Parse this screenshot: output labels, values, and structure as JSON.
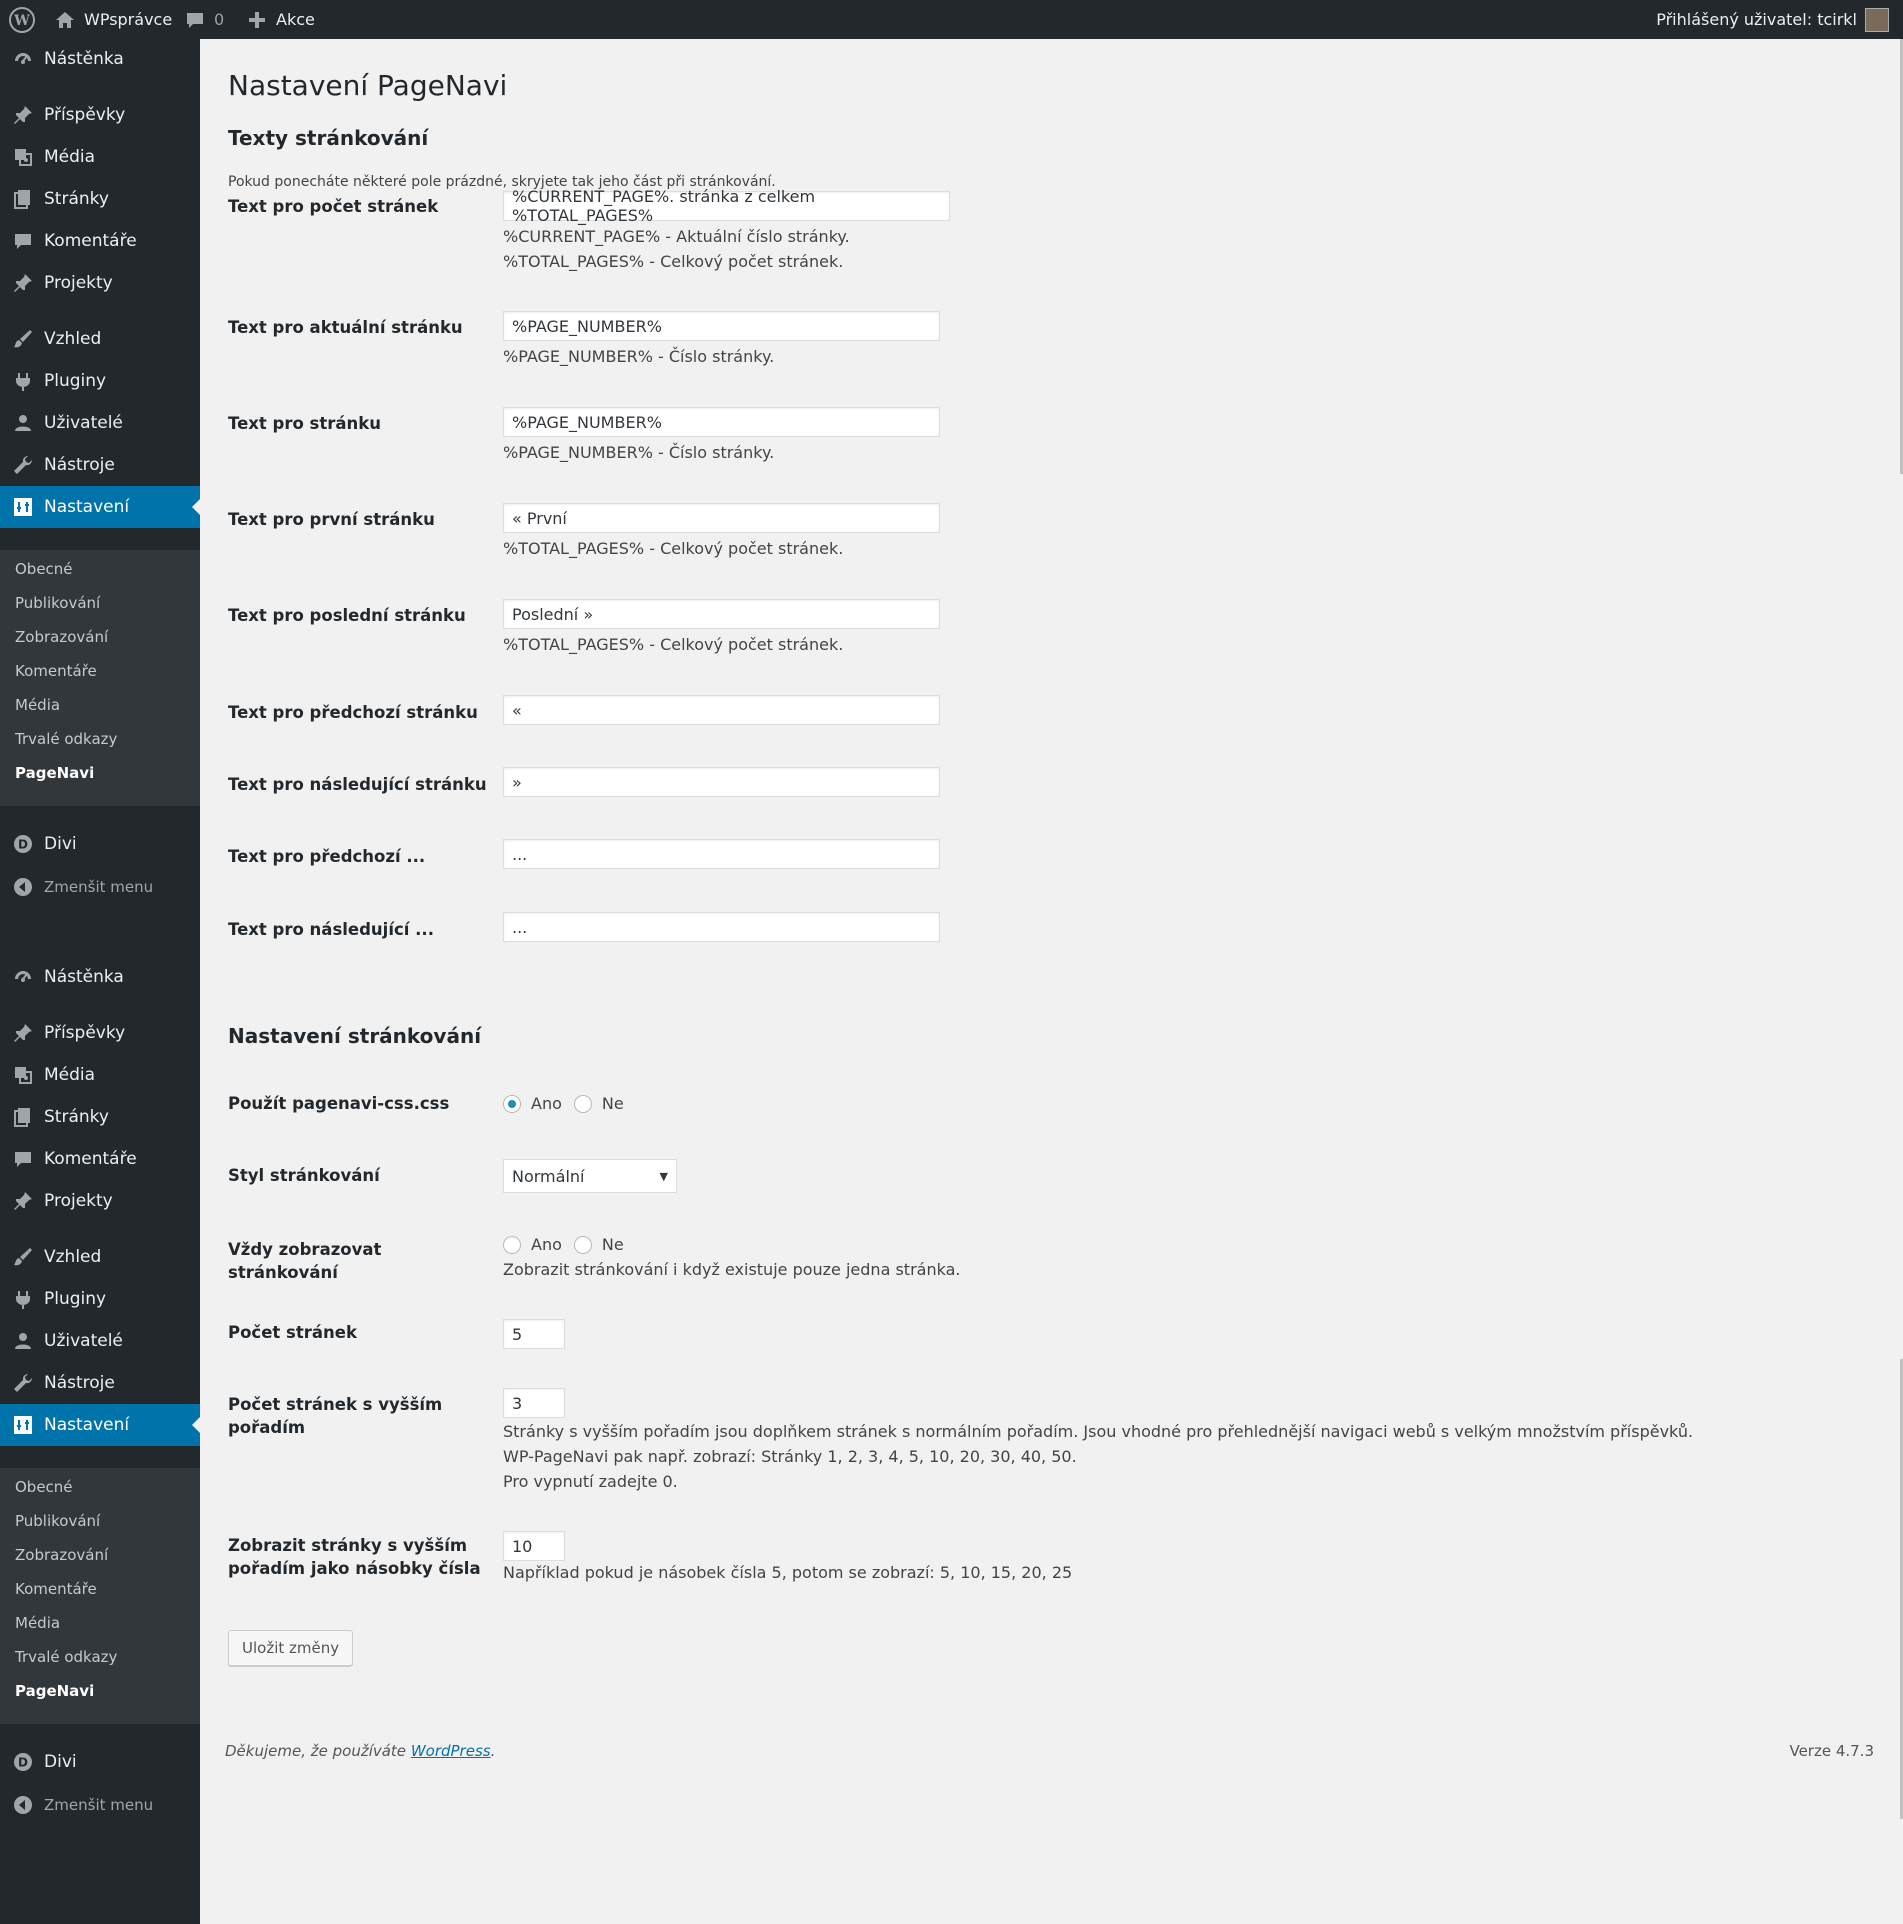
{
  "adminbar": {
    "site_name": "WPsprávce",
    "comments_count": "0",
    "new_label": "Akce",
    "user_greeting": "Přihlášený uživatel: tcirkl"
  },
  "sidebar": {
    "items": [
      {
        "label": "Nástěnka",
        "icon": "dashboard-icon"
      },
      {
        "label": "Příspěvky",
        "icon": "pin-icon"
      },
      {
        "label": "Média",
        "icon": "media-icon"
      },
      {
        "label": "Stránky",
        "icon": "pages-icon"
      },
      {
        "label": "Komentáře",
        "icon": "comment-icon"
      },
      {
        "label": "Projekty",
        "icon": "pin-icon"
      },
      {
        "label": "Vzhled",
        "icon": "brush-icon"
      },
      {
        "label": "Pluginy",
        "icon": "plugin-icon"
      },
      {
        "label": "Uživatelé",
        "icon": "user-icon"
      },
      {
        "label": "Nástroje",
        "icon": "wrench-icon"
      },
      {
        "label": "Nastavení",
        "icon": "settings-icon"
      }
    ],
    "submenu": [
      "Obecné",
      "Publikování",
      "Zobrazování",
      "Komentáře",
      "Média",
      "Trvalé odkazy",
      "PageNavi"
    ],
    "divi": "Divi",
    "collapse": "Zmenšit menu"
  },
  "page": {
    "title": "Nastavení PageNavi",
    "section1_title": "Texty stránkování",
    "section1_intro": "Pokud ponecháte některé pole prázdné, skryjete tak jeho část při stránkování.",
    "rows": [
      {
        "label": "Text pro počet stránek",
        "value": "%CURRENT_PAGE%. stránka z celkem %TOTAL_PAGES%",
        "desc": [
          "%CURRENT_PAGE% - Aktuální číslo stránky.",
          "%TOTAL_PAGES% - Celkový počet stránek."
        ]
      },
      {
        "label": "Text pro aktuální stránku",
        "value": "%PAGE_NUMBER%",
        "desc": [
          "%PAGE_NUMBER% - Číslo stránky."
        ]
      },
      {
        "label": "Text pro stránku",
        "value": "%PAGE_NUMBER%",
        "desc": [
          "%PAGE_NUMBER% - Číslo stránky."
        ]
      },
      {
        "label": "Text pro první stránku",
        "value": "« První",
        "desc": [
          "%TOTAL_PAGES% - Celkový počet stránek."
        ]
      },
      {
        "label": "Text pro poslední stránku",
        "value": "Poslední »",
        "desc": [
          "%TOTAL_PAGES% - Celkový počet stránek."
        ]
      },
      {
        "label": "Text pro předchozí stránku",
        "value": "«"
      },
      {
        "label": "Text pro následující stránku",
        "value": "»"
      },
      {
        "label": "Text pro předchozí ...",
        "value": "..."
      },
      {
        "label": "Text pro následující ...",
        "value": "..."
      }
    ],
    "section2_title": "Nastavení stránkování",
    "use_css": {
      "label": "Použít pagenavi-css.css",
      "yes": "Ano",
      "no": "Ne",
      "selected": "Ano"
    },
    "style": {
      "label": "Styl stránkování",
      "value": "Normální"
    },
    "always_show": {
      "label": "Vždy zobrazovat stránkování",
      "yes": "Ano",
      "no": "Ne",
      "selected": "",
      "desc": "Zobrazit stránkování i když existuje pouze jedna stránka."
    },
    "num_pages": {
      "label": "Počet stránek",
      "value": "5"
    },
    "larger_pages": {
      "label": "Počet stránek s vyšším pořadím",
      "value": "3",
      "desc": [
        "Stránky s vyšším pořadím jsou doplňkem stránek s normálním pořadím. Jsou vhodné pro přehlednější navigaci webů s velkým množstvím příspěvků.",
        "WP-PageNavi pak např. zobrazí: Stránky 1, 2, 3, 4, 5, 10, 20, 30, 40, 50.",
        "Pro vypnutí zadejte 0."
      ]
    },
    "larger_multiple": {
      "label_line1": "Zobrazit stránky s vyšším",
      "label_line2": "pořadím jako násobky čísla",
      "value": "10",
      "desc": "Například pokud je násobek čísla 5, potom se zobrazí: 5, 10, 15, 20, 25"
    },
    "save_label": "Uložit změny"
  },
  "footer": {
    "thanks_prefix": "Děkujeme, že používáte ",
    "thanks_link": "WordPress",
    "thanks_suffix": ".",
    "version": "Verze 4.7.3"
  },
  "colors": {
    "adminbar": "#23282d",
    "accent": "#0073aa",
    "background": "#f1f1f1"
  }
}
